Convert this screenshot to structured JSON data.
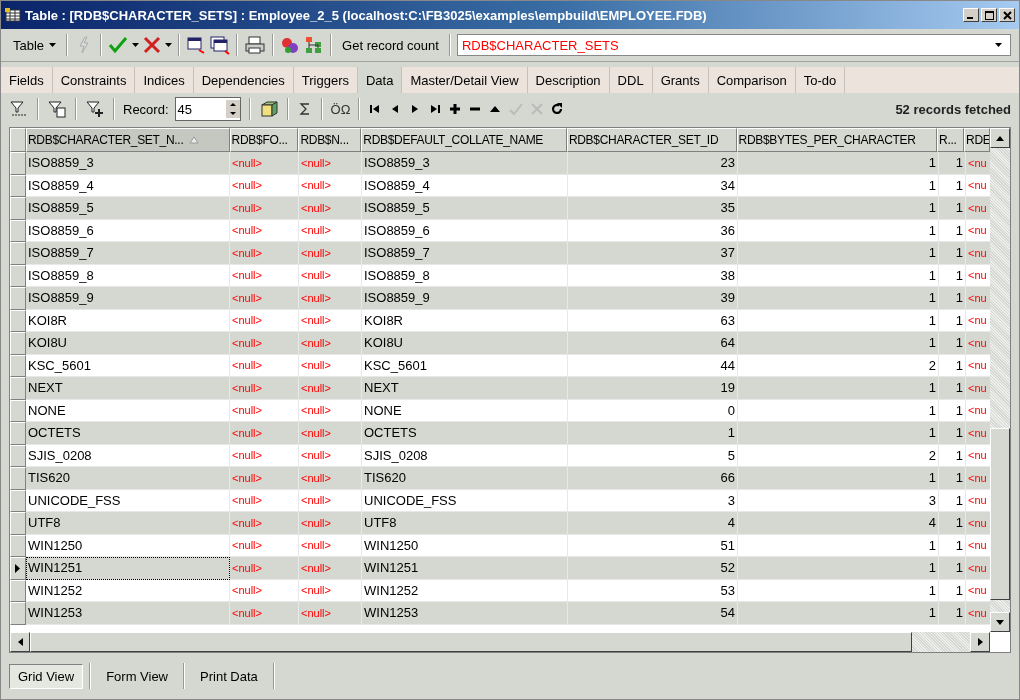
{
  "window": {
    "title": "Table : [RDB$CHARACTER_SETS] : Employee_2_5 (localhost:C:\\FB3025\\examples\\empbuild\\EMPLOYEE.FDB)"
  },
  "toolbar": {
    "table_button": "Table",
    "record_count_button": "Get record count",
    "object_combo": "RDB$CHARACTER_SETS"
  },
  "tabs": [
    {
      "label": "Fields",
      "selected": false
    },
    {
      "label": "Constraints",
      "selected": false
    },
    {
      "label": "Indices",
      "selected": false
    },
    {
      "label": "Dependencies",
      "selected": false
    },
    {
      "label": "Triggers",
      "selected": false
    },
    {
      "label": "Data",
      "selected": true
    },
    {
      "label": "Master/Detail View",
      "selected": false
    },
    {
      "label": "Description",
      "selected": false
    },
    {
      "label": "DDL",
      "selected": false
    },
    {
      "label": "Grants",
      "selected": false
    },
    {
      "label": "Comparison",
      "selected": false
    },
    {
      "label": "To-do",
      "selected": false
    }
  ],
  "data_toolbar": {
    "record_label": "Record:",
    "record_value": "45",
    "symbols_button": "ÖΩ",
    "status": "52 records fetched"
  },
  "grid": {
    "columns": [
      {
        "label": "RDB$CHARACTER_SET_N...",
        "sorted": true
      },
      {
        "label": "RDB$FO...",
        "sorted": false
      },
      {
        "label": "RDB$N...",
        "sorted": false
      },
      {
        "label": "RDB$DEFAULT_COLLATE_NAME",
        "sorted": false
      },
      {
        "label": "RDB$CHARACTER_SET_ID",
        "sorted": false
      },
      {
        "label": "RDB$BYTES_PER_CHARACTER",
        "sorted": false
      },
      {
        "label": "R...",
        "sorted": false
      },
      {
        "label": "RDE",
        "sorted": false
      }
    ],
    "rows": [
      {
        "selected": false,
        "cells": [
          "ISO8859_3",
          "<null>",
          "<null>",
          "ISO8859_3",
          "23",
          "1",
          "1",
          "<nu"
        ]
      },
      {
        "selected": false,
        "cells": [
          "ISO8859_4",
          "<null>",
          "<null>",
          "ISO8859_4",
          "34",
          "1",
          "1",
          "<nu"
        ]
      },
      {
        "selected": false,
        "cells": [
          "ISO8859_5",
          "<null>",
          "<null>",
          "ISO8859_5",
          "35",
          "1",
          "1",
          "<nu"
        ]
      },
      {
        "selected": false,
        "cells": [
          "ISO8859_6",
          "<null>",
          "<null>",
          "ISO8859_6",
          "36",
          "1",
          "1",
          "<nu"
        ]
      },
      {
        "selected": false,
        "cells": [
          "ISO8859_7",
          "<null>",
          "<null>",
          "ISO8859_7",
          "37",
          "1",
          "1",
          "<nu"
        ]
      },
      {
        "selected": false,
        "cells": [
          "ISO8859_8",
          "<null>",
          "<null>",
          "ISO8859_8",
          "38",
          "1",
          "1",
          "<nu"
        ]
      },
      {
        "selected": false,
        "cells": [
          "ISO8859_9",
          "<null>",
          "<null>",
          "ISO8859_9",
          "39",
          "1",
          "1",
          "<nu"
        ]
      },
      {
        "selected": false,
        "cells": [
          "KOI8R",
          "<null>",
          "<null>",
          "KOI8R",
          "63",
          "1",
          "1",
          "<nu"
        ]
      },
      {
        "selected": false,
        "cells": [
          "KOI8U",
          "<null>",
          "<null>",
          "KOI8U",
          "64",
          "1",
          "1",
          "<nu"
        ]
      },
      {
        "selected": false,
        "cells": [
          "KSC_5601",
          "<null>",
          "<null>",
          "KSC_5601",
          "44",
          "2",
          "1",
          "<nu"
        ]
      },
      {
        "selected": false,
        "cells": [
          "NEXT",
          "<null>",
          "<null>",
          "NEXT",
          "19",
          "1",
          "1",
          "<nu"
        ]
      },
      {
        "selected": false,
        "cells": [
          "NONE",
          "<null>",
          "<null>",
          "NONE",
          "0",
          "1",
          "1",
          "<nu"
        ]
      },
      {
        "selected": false,
        "cells": [
          "OCTETS",
          "<null>",
          "<null>",
          "OCTETS",
          "1",
          "1",
          "1",
          "<nu"
        ]
      },
      {
        "selected": false,
        "cells": [
          "SJIS_0208",
          "<null>",
          "<null>",
          "SJIS_0208",
          "5",
          "2",
          "1",
          "<nu"
        ]
      },
      {
        "selected": false,
        "cells": [
          "TIS620",
          "<null>",
          "<null>",
          "TIS620",
          "66",
          "1",
          "1",
          "<nu"
        ]
      },
      {
        "selected": false,
        "cells": [
          "UNICODE_FSS",
          "<null>",
          "<null>",
          "UNICODE_FSS",
          "3",
          "3",
          "1",
          "<nu"
        ]
      },
      {
        "selected": false,
        "cells": [
          "UTF8",
          "<null>",
          "<null>",
          "UTF8",
          "4",
          "4",
          "1",
          "<nu"
        ]
      },
      {
        "selected": false,
        "cells": [
          "WIN1250",
          "<null>",
          "<null>",
          "WIN1250",
          "51",
          "1",
          "1",
          "<nu"
        ]
      },
      {
        "selected": true,
        "cells": [
          "WIN1251",
          "<null>",
          "<null>",
          "WIN1251",
          "52",
          "1",
          "1",
          "<nu"
        ]
      },
      {
        "selected": false,
        "cells": [
          "WIN1252",
          "<null>",
          "<null>",
          "WIN1252",
          "53",
          "1",
          "1",
          "<nu"
        ]
      },
      {
        "selected": false,
        "cells": [
          "WIN1253",
          "<null>",
          "<null>",
          "WIN1253",
          "54",
          "1",
          "1",
          "<nu"
        ]
      }
    ]
  },
  "view_tabs": [
    {
      "label": "Grid View",
      "selected": true
    },
    {
      "label": "Form View",
      "selected": false
    },
    {
      "label": "Print Data",
      "selected": false
    }
  ]
}
